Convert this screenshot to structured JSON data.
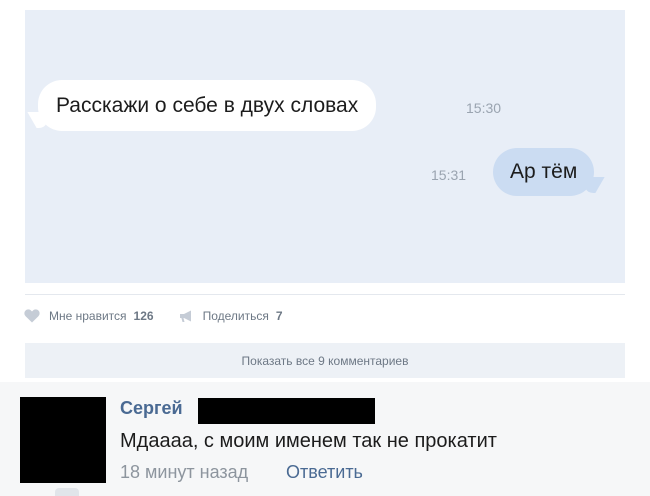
{
  "post": {
    "chat": {
      "incoming": {
        "text": "Расскажи о себе в двух словах",
        "time": "15:30"
      },
      "outgoing": {
        "text": "Ар тём",
        "time": "15:31"
      }
    },
    "actions": {
      "like": {
        "label": "Мне нравится",
        "count": "126",
        "icon": "heart-icon"
      },
      "share": {
        "label": "Поделиться",
        "count": "7",
        "icon": "megaphone-icon"
      }
    },
    "show_all_comments": "Показать все 9 комментариев"
  },
  "comment": {
    "author": "Сергей",
    "text": "Мдаааа, с моим именем так не прокатит",
    "time": "18 минут назад",
    "reply_label": "Ответить"
  },
  "colors": {
    "chat_bg": "#e8eef7",
    "outgoing_bubble": "#cbdcf2",
    "link": "#4a6a93",
    "muted": "#6d7885"
  }
}
